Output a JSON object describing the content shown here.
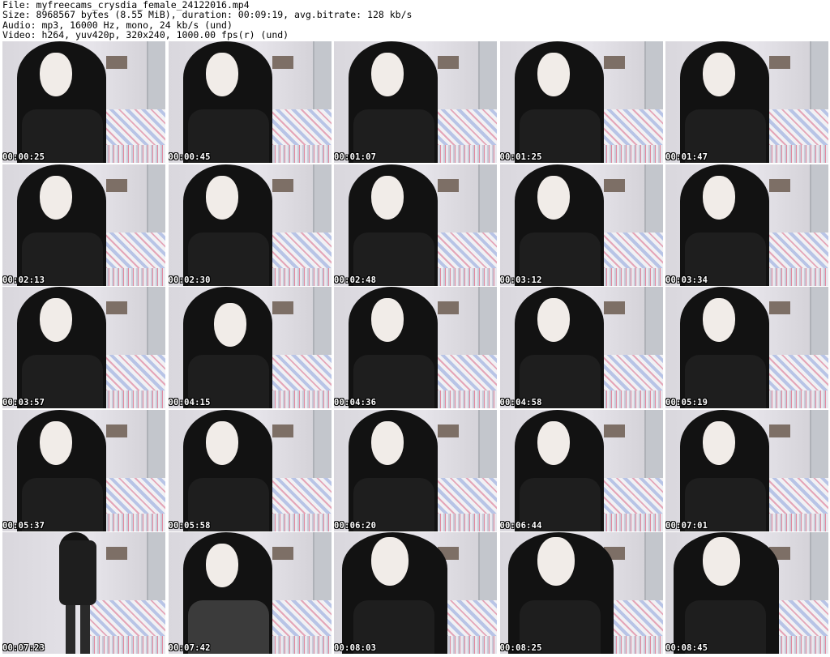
{
  "header": {
    "file": "File: myfreecams_crysdia_female_24122016.mp4",
    "size": "Size: 8968567 bytes (8.55 MiB), duration: 00:09:19, avg.bitrate: 128 kb/s",
    "audio": "Audio: mp3, 16000 Hz, mono, 24 kb/s (und)",
    "video": "Video: h264, yuv420p, 320x240, 1000.00 fps(r) (und)"
  },
  "thumbnails": [
    {
      "time": "00:00:25",
      "variant": "default"
    },
    {
      "time": "00:00:45",
      "variant": "default"
    },
    {
      "time": "00:01:07",
      "variant": "default"
    },
    {
      "time": "00:01:25",
      "variant": "default"
    },
    {
      "time": "00:01:47",
      "variant": "default"
    },
    {
      "time": "00:02:13",
      "variant": "default"
    },
    {
      "time": "00:02:30",
      "variant": "default"
    },
    {
      "time": "00:02:48",
      "variant": "default"
    },
    {
      "time": "00:03:12",
      "variant": "default"
    },
    {
      "time": "00:03:34",
      "variant": "default"
    },
    {
      "time": "00:03:57",
      "variant": "default"
    },
    {
      "time": "00:04:15",
      "variant": "tilt"
    },
    {
      "time": "00:04:36",
      "variant": "default"
    },
    {
      "time": "00:04:58",
      "variant": "default"
    },
    {
      "time": "00:05:19",
      "variant": "default"
    },
    {
      "time": "00:05:37",
      "variant": "default"
    },
    {
      "time": "00:05:58",
      "variant": "default"
    },
    {
      "time": "00:06:20",
      "variant": "default"
    },
    {
      "time": "00:06:44",
      "variant": "default"
    },
    {
      "time": "00:07:01",
      "variant": "default"
    },
    {
      "time": "00:07:23",
      "variant": "standing"
    },
    {
      "time": "00:07:42",
      "variant": "shirt"
    },
    {
      "time": "00:08:03",
      "variant": "close"
    },
    {
      "time": "00:08:25",
      "variant": "close"
    },
    {
      "time": "00:08:45",
      "variant": "close"
    }
  ]
}
